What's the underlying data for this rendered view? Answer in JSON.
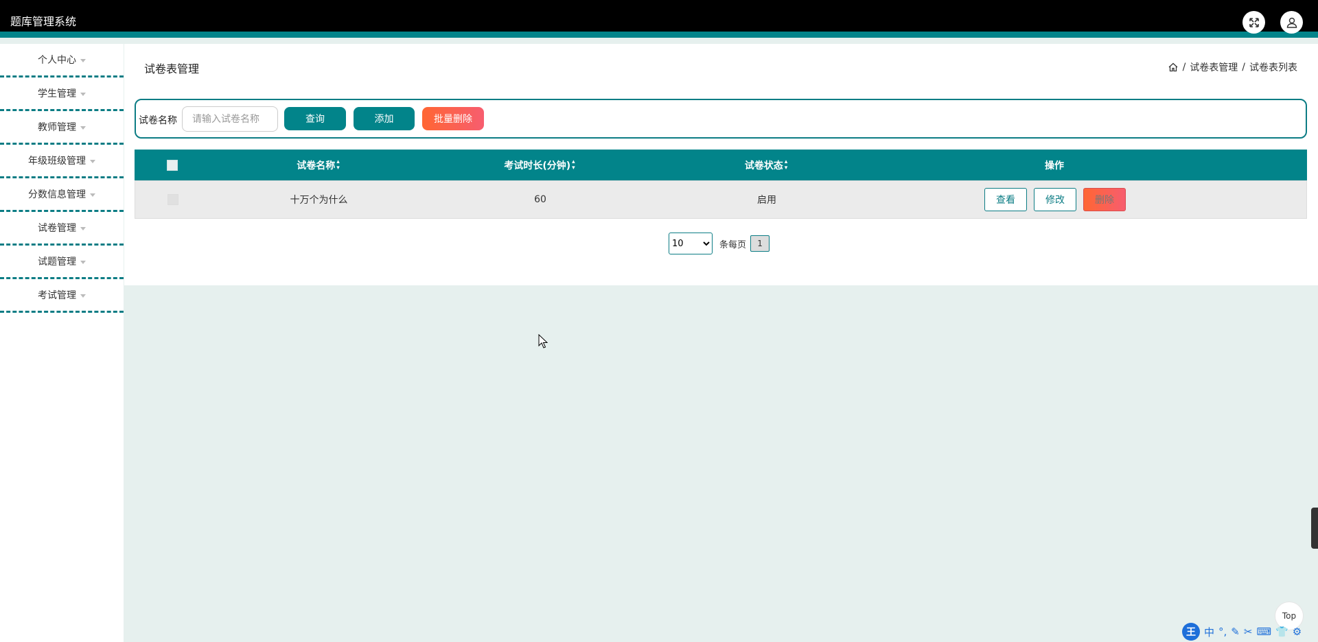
{
  "header": {
    "app_title": "题库管理系统",
    "fullscreen_icon": "expand-arrows-icon",
    "user_icon": "user-icon"
  },
  "sidebar": {
    "items": [
      {
        "label": "个人中心"
      },
      {
        "label": "学生管理"
      },
      {
        "label": "教师管理"
      },
      {
        "label": "年级班级管理"
      },
      {
        "label": "分数信息管理"
      },
      {
        "label": "试卷管理"
      },
      {
        "label": "试题管理"
      },
      {
        "label": "考试管理"
      }
    ]
  },
  "main": {
    "page_title": "试卷表管理",
    "breadcrumb": {
      "home_icon": "home-icon",
      "sep": "/",
      "level1": "试卷表管理",
      "level2": "试卷表列表"
    },
    "search": {
      "label": "试卷名称",
      "placeholder": "请输入试卷名称",
      "value": "",
      "query_button": "查询",
      "add_button": "添加",
      "batch_delete_button": "批量删除"
    },
    "table": {
      "columns": [
        "试卷名称",
        "考试时长(分钟)",
        "试卷状态",
        "操作"
      ],
      "rows": [
        {
          "name": "十万个为什么",
          "duration": "60",
          "status": "启用"
        }
      ],
      "actions": {
        "view": "查看",
        "edit": "修改",
        "delete": "删除"
      }
    },
    "pagination": {
      "page_size": "10",
      "page_size_options": [
        "10"
      ],
      "per_page_text": "条每页",
      "current_page": "1"
    }
  },
  "misc": {
    "top_button": "Top",
    "ime_logo": "王",
    "ime_mode": "中"
  },
  "colors": {
    "primary": "#02848a",
    "danger_gradient_start": "#ff6633",
    "danger_gradient_end": "#f75d6f",
    "header_bg": "#000000",
    "content_bg": "#e6f0ee"
  }
}
